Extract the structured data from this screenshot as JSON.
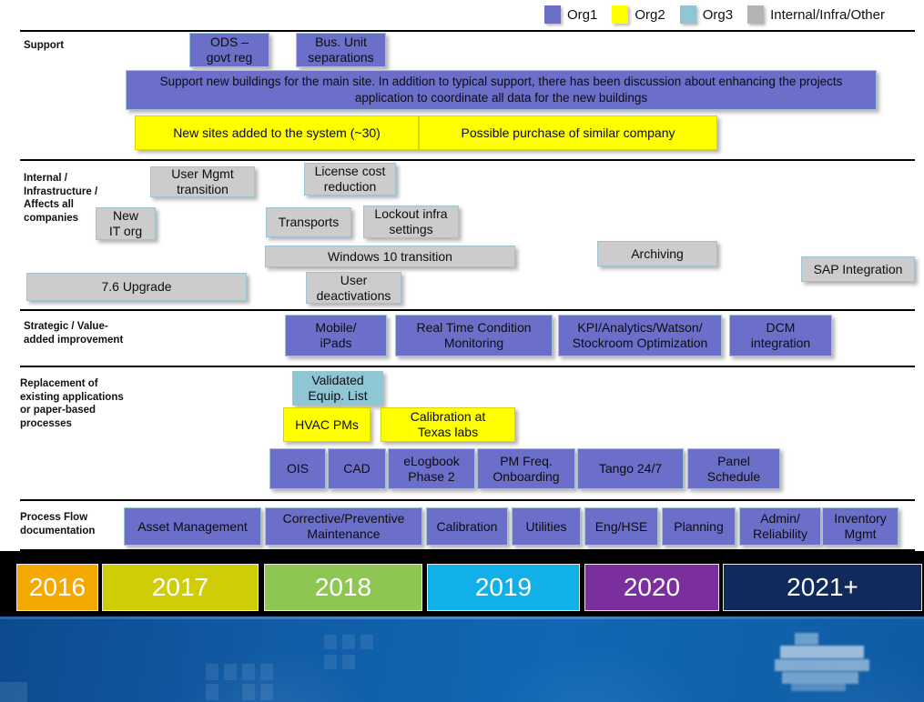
{
  "legend": {
    "items": [
      {
        "label": "Org1",
        "color": "#6b6fc9",
        "icon": "color-swatch-icon"
      },
      {
        "label": "Org2",
        "color": "#ffff00",
        "icon": "color-swatch-icon"
      },
      {
        "label": "Org3",
        "color": "#8ec6d4",
        "icon": "color-swatch-icon"
      },
      {
        "label": "Internal/Infra/Other",
        "color": "#b3b3b3",
        "icon": "color-swatch-icon"
      }
    ]
  },
  "rows": [
    {
      "id": "support",
      "label": "Support",
      "items": [
        {
          "text": "ODS –\ngovt reg",
          "org": "org1"
        },
        {
          "text": "Bus. Unit\nseparations",
          "org": "org1"
        },
        {
          "text": "Support new buildings for the main site. In addition to typical support, there has been discussion about enhancing the projects application to coordinate all data for the new buildings",
          "org": "org1"
        },
        {
          "text": "New sites added to the system (~30)",
          "org": "org2"
        },
        {
          "text": "Possible purchase of similar company",
          "org": "org2"
        }
      ]
    },
    {
      "id": "internal-infrastructure",
      "label": "Internal /\nInfrastructure /\nAffects all\ncompanies",
      "items": [
        {
          "text": "User Mgmt\ntransition",
          "org": "other"
        },
        {
          "text": "License cost\nreduction",
          "org": "other"
        },
        {
          "text": "New\nIT org",
          "org": "other"
        },
        {
          "text": "Transports",
          "org": "other"
        },
        {
          "text": "Lockout infra\nsettings",
          "org": "other"
        },
        {
          "text": "Windows 10 transition",
          "org": "other"
        },
        {
          "text": "Archiving",
          "org": "other"
        },
        {
          "text": "SAP Integration",
          "org": "other"
        },
        {
          "text": "7.6 Upgrade",
          "org": "other"
        },
        {
          "text": "User\ndeactivations",
          "org": "other"
        }
      ]
    },
    {
      "id": "strategic-value-added",
      "label": "Strategic / Value-\nadded improvement",
      "items": [
        {
          "text": "Mobile/\niPads",
          "org": "org1"
        },
        {
          "text": "Real Time Condition\nMonitoring",
          "org": "org1"
        },
        {
          "text": "KPI/Analytics/Watson/\nStockroom Optimization",
          "org": "org1"
        },
        {
          "text": "DCM\nintegration",
          "org": "org1"
        }
      ]
    },
    {
      "id": "replacement-existing-applications",
      "label": "Replacement of\nexisting applications\nor paper-based\nprocesses",
      "items": [
        {
          "text": "Validated\nEquip. List",
          "org": "org3"
        },
        {
          "text": "HVAC PMs",
          "org": "org2"
        },
        {
          "text": "Calibration at\nTexas labs",
          "org": "org2"
        },
        {
          "text": "OIS",
          "org": "org1"
        },
        {
          "text": "CAD",
          "org": "org1"
        },
        {
          "text": "eLogbook\nPhase 2",
          "org": "org1"
        },
        {
          "text": "PM Freq.\nOnboarding",
          "org": "org1"
        },
        {
          "text": "Tango 24/7",
          "org": "org1"
        },
        {
          "text": "Panel\nSchedule",
          "org": "org1"
        }
      ]
    },
    {
      "id": "process-flow-documentation",
      "label": "Process Flow\ndocumentation",
      "items": [
        {
          "text": "Asset Management",
          "org": "org1"
        },
        {
          "text": "Corrective/Preventive\nMaintenance",
          "org": "org1"
        },
        {
          "text": "Calibration",
          "org": "org1"
        },
        {
          "text": "Utilities",
          "org": "org1"
        },
        {
          "text": "Eng/HSE",
          "org": "org1"
        },
        {
          "text": "Planning",
          "org": "org1"
        },
        {
          "text": "Admin/\nReliability",
          "org": "org1"
        },
        {
          "text": "Inventory\nMgmt",
          "org": "org1"
        }
      ]
    }
  ],
  "timeline": {
    "years": [
      {
        "label": "2016",
        "color": "#f5a800"
      },
      {
        "label": "2017",
        "color": "#cfcc08"
      },
      {
        "label": "2018",
        "color": "#8dc653"
      },
      {
        "label": "2019",
        "color": "#12b0e8"
      },
      {
        "label": "2020",
        "color": "#7b2f9e"
      },
      {
        "label": "2021+",
        "color": "#102a5c"
      }
    ]
  }
}
